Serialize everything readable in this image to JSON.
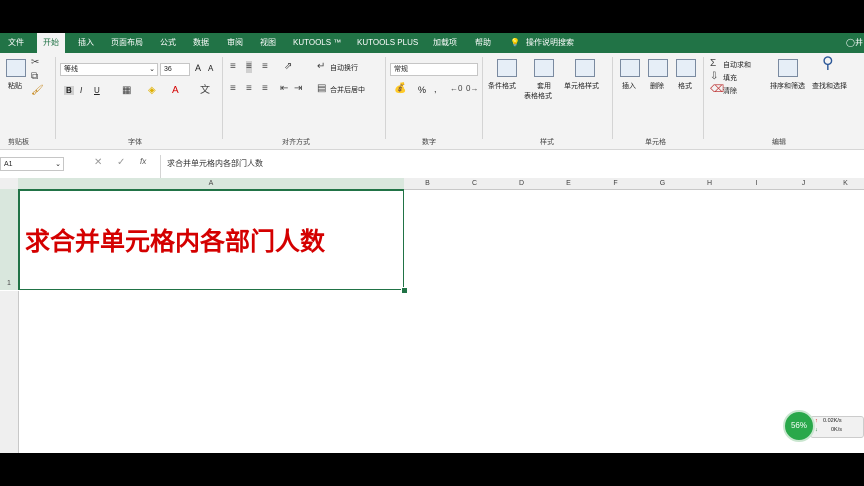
{
  "ribbon": {
    "tabs": [
      "文件",
      "开始",
      "插入",
      "页面布局",
      "公式",
      "数据",
      "审阅",
      "视图",
      "KUTOOLS ™",
      "KUTOOLS PLUS",
      "加载项",
      "帮助",
      "操作说明搜索"
    ],
    "active_tab": "开始",
    "clipboard": {
      "paste": "粘贴",
      "label": "剪贴板"
    },
    "font": {
      "name": "等线",
      "size": "36",
      "grow": "A",
      "shrink": "A",
      "bold": "B",
      "italic": "I",
      "underline": "U",
      "label": "字体"
    },
    "alignment": {
      "wrap": "自动换行",
      "merge": "合并后居中",
      "label": "对齐方式"
    },
    "number": {
      "format": "常规",
      "percent": "%",
      "comma": ",",
      "label": "数字"
    },
    "styles": {
      "conditional": "条件格式",
      "table": "套用",
      "table2": "表格格式",
      "cell_styles": "单元格样式",
      "label": "样式"
    },
    "cells": {
      "insert": "插入",
      "delete": "删除",
      "format": "格式",
      "label": "单元格"
    },
    "editing": {
      "autosum": "自动求和",
      "fill": "填充",
      "clear": "清除",
      "sort": "排序和筛选",
      "find": "查找和选择",
      "label": "编辑"
    },
    "user_initial": "井"
  },
  "formula_bar": {
    "name_box": "A1",
    "fx": "fx",
    "content": "求合并单元格内各部门人数"
  },
  "columns": [
    "A",
    "B",
    "C",
    "D",
    "E",
    "F",
    "G",
    "H",
    "I",
    "J",
    "K"
  ],
  "rows": [
    "1"
  ],
  "cell_A1": "求合并单元格内各部门人数",
  "net_widget": {
    "percent": "56%",
    "up": "0.02K/s",
    "down": "0K/s"
  },
  "colors": {
    "excel_green": "#217346",
    "cell_text": "#d40000"
  }
}
